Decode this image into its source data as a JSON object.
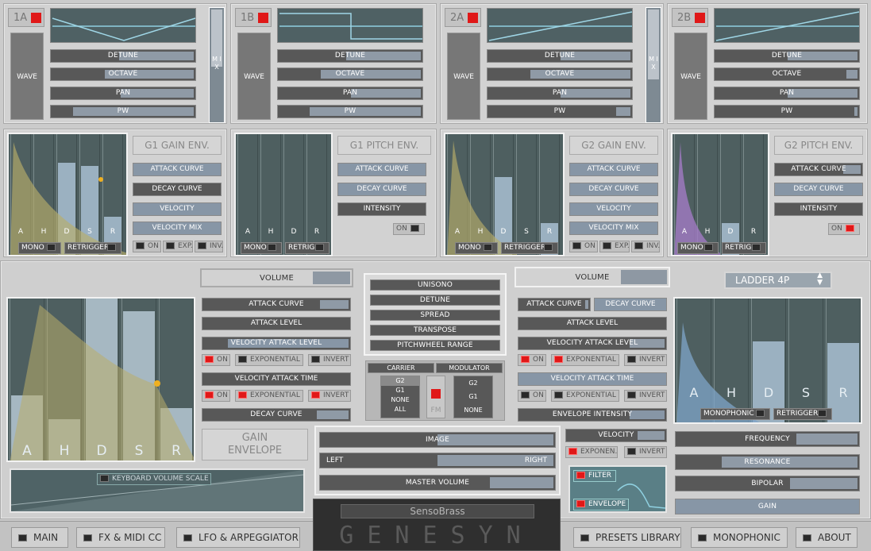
{
  "osc": {
    "a1": {
      "id": "1A",
      "wave": "WAVE"
    },
    "b1": {
      "id": "1B",
      "wave": "WAVE"
    },
    "a2": {
      "id": "2A",
      "wave": "WAVE"
    },
    "b2": {
      "id": "2B",
      "wave": "WAVE"
    },
    "sliders": {
      "detune": "DETUNE",
      "octave": "OCTAVE",
      "pan": "PAN",
      "pw": "PW"
    },
    "mix": "M I X"
  },
  "env_small": {
    "g1_gain": {
      "title": "G1 GAIN ENV.",
      "btns": [
        "ATTACK CURVE",
        "DECAY CURVE",
        "VELOCITY",
        "VELOCITY MIX"
      ],
      "mono": "MONO",
      "retrig": "RETRIGGER",
      "on": "ON",
      "exp": "EXP.",
      "inv": "INV."
    },
    "g1_pitch": {
      "title": "G1 PITCH ENV.",
      "btns": [
        "ATTACK CURVE",
        "DECAY CURVE",
        "INTENSITY"
      ],
      "mono": "MONO",
      "retrig": "RETRIG.",
      "on": "ON"
    },
    "g2_gain": {
      "title": "G2 GAIN ENV.",
      "btns": [
        "ATTACK CURVE",
        "DECAY CURVE",
        "VELOCITY",
        "VELOCITY MIX"
      ],
      "mono": "MONO",
      "retrig": "RETRIGGER",
      "on": "ON",
      "exp": "EXP.",
      "inv": "INV."
    },
    "g2_pitch": {
      "title": "G2 PITCH ENV.",
      "btns": [
        "ATTACK CURVE",
        "DECAY CURVE",
        "INTENSITY"
      ],
      "mono": "MONO",
      "retrig": "RETRIG.",
      "on": "ON"
    },
    "stage_labels": [
      "A",
      "H",
      "D",
      "S",
      "R"
    ],
    "pitch_labels": [
      "A",
      "H",
      "D",
      "R"
    ]
  },
  "gain": {
    "volume": "VOLUME",
    "attack_curve": "ATTACK CURVE",
    "attack_level": "ATTACK LEVEL",
    "vel_attack_level": "VELOCITY ATTACK LEVEL",
    "on": "ON",
    "exponential": "EXPONENTIAL",
    "invert": "INVERT",
    "vel_attack_time": "VELOCITY ATTACK TIME",
    "decay_curve": "DECAY CURVE",
    "title_line1": "GAIN",
    "title_line2": "ENVELOPE",
    "kbd": "KEYBOARD VOLUME SCALE"
  },
  "center": {
    "unisono": "UNISONO",
    "detune": "DETUNE",
    "spread": "SPREAD",
    "transpose": "TRANSPOSE",
    "pitchwheel": "PITCHWHEEL RANGE",
    "carrier": "CARRIER",
    "modulator": "MODULATOR",
    "carrier_opts": [
      "G2",
      "G1",
      "NONE",
      "ALL"
    ],
    "mod_opts": [
      "G2",
      "G1",
      "NONE"
    ],
    "fm": "FM",
    "image": "IMAGE",
    "left": "LEFT",
    "right": "RIGHT",
    "master": "MASTER VOLUME",
    "preset": "SensoBrass",
    "logo": "GENESYN"
  },
  "filter": {
    "volume": "VOLUME",
    "attack_curve": "ATTACK CURVE",
    "decay_curve": "DECAY CURVE",
    "attack_level": "ATTACK LEVEL",
    "vel_attack_level": "VELOCITY ATTACK LEVEL",
    "on": "ON",
    "exponential": "EXPONENTIAL",
    "invert": "INVERT",
    "vel_attack_time": "VELOCITY ATTACK TIME",
    "env_intensity": "ENVELOPE INTENSITY",
    "velocity": "VELOCITY",
    "exponen": "EXPONEN.",
    "invert2": "INVERT",
    "type": "LADDER 4P",
    "monophonic": "MONOPHONIC",
    "retrigger": "RETRIGGER",
    "frequency": "FREQUENCY",
    "resonance": "RESONANCE",
    "bipolar": "BIPOLAR",
    "gain": "GAIN",
    "flt": "FILTER",
    "envelope": "ENVELOPE"
  },
  "tabs": {
    "main": "MAIN",
    "fx": "FX & MIDI CC",
    "lfo": "LFO & ARPEGGIATOR",
    "presets": "PRESETS LIBRARY",
    "mono": "MONOPHONIC",
    "about": "ABOUT"
  },
  "colors": {
    "accent_red": "#e01818",
    "env_fill_yellow": "#b9ad6a",
    "env_fill_purple": "#a37bc4",
    "env_fill_blue": "#7fa4c8"
  }
}
